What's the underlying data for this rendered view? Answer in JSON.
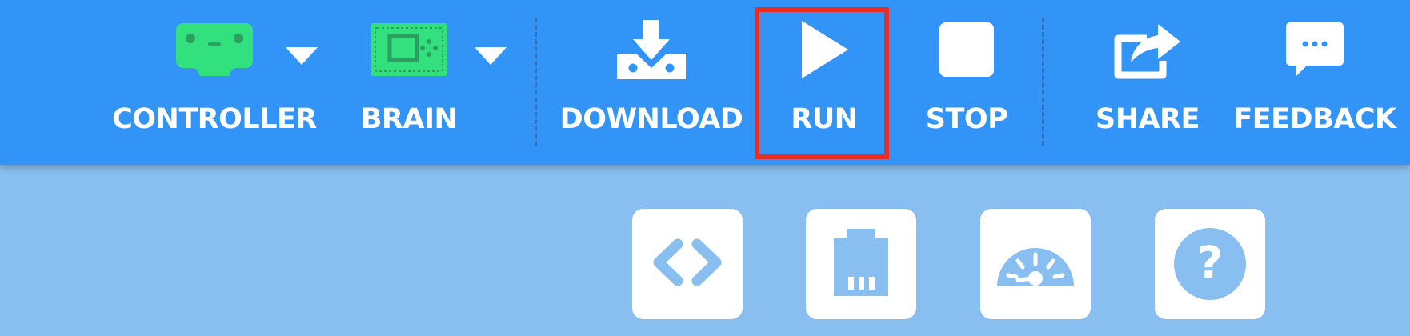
{
  "toolbar": {
    "items": [
      {
        "id": "controller",
        "label": "CONTROLLER",
        "icon": "controller-icon"
      },
      {
        "id": "brain",
        "label": "BRAIN",
        "icon": "brain-icon"
      },
      {
        "id": "download",
        "label": "DOWNLOAD",
        "icon": "download-icon"
      },
      {
        "id": "run",
        "label": "RUN",
        "icon": "play-icon"
      },
      {
        "id": "stop",
        "label": "STOP",
        "icon": "stop-icon"
      },
      {
        "id": "share",
        "label": "SHARE",
        "icon": "share-icon"
      },
      {
        "id": "feedback",
        "label": "FEEDBACK",
        "icon": "chat-bubble-icon"
      }
    ],
    "dropdown_icon": "caret-down-icon",
    "highlighted_item": "run"
  },
  "side_buttons": [
    {
      "id": "code",
      "icon": "code-brackets-icon"
    },
    {
      "id": "devices",
      "icon": "ports-icon"
    },
    {
      "id": "dashboard",
      "icon": "gauge-icon"
    },
    {
      "id": "help",
      "icon": "help-icon",
      "glyph": "?"
    }
  ],
  "colors": {
    "toolbar_bg": "#3394f8",
    "workspace_bg": "#88bff0",
    "device_icon": "#33e07e",
    "highlight": "#ea2d22"
  }
}
